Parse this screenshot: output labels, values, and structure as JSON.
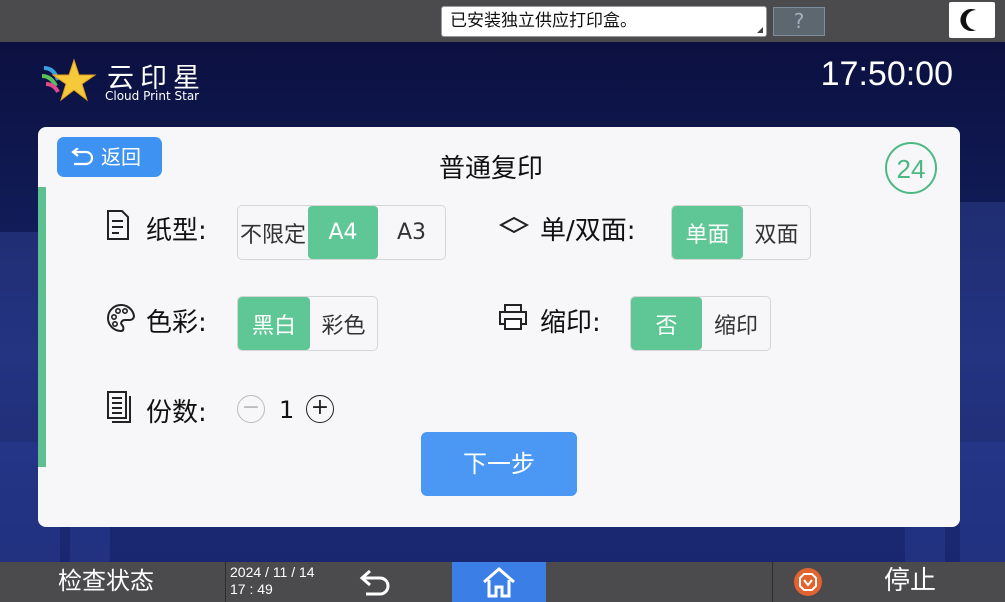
{
  "topbar": {
    "message": "已安装独立供应打印盒。",
    "help_label": "?",
    "moon_icon": "moon-icon"
  },
  "header": {
    "logo_title": "云印星",
    "logo_subtitle": "Cloud Print Star",
    "clock": "17:50:00"
  },
  "panel": {
    "back_label": "返回",
    "title": "普通复印",
    "counter": "24",
    "paper": {
      "label": "纸型:",
      "options": [
        "不限定",
        "A4",
        "A3"
      ],
      "selected": "A4"
    },
    "duplex": {
      "label": "单/双面:",
      "options": [
        "单面",
        "双面"
      ],
      "selected": "单面"
    },
    "color": {
      "label": "色彩:",
      "options": [
        "黑白",
        "彩色"
      ],
      "selected": "黑白"
    },
    "shrink": {
      "label": "缩印:",
      "options": [
        "否",
        "缩印"
      ],
      "selected": "否"
    },
    "copies": {
      "label": "份数:",
      "value": "1",
      "minus": "−",
      "plus": "+"
    },
    "next_label": "下一步"
  },
  "bottombar": {
    "check_status": "检查状态",
    "date_line1": "2024 / 11 / 14",
    "date_line2": "17 : 49",
    "stop_label": "停止"
  },
  "colors": {
    "accent_green": "#5fc795",
    "accent_blue": "#4a98f3",
    "bar_gray": "#4b4b4d",
    "stop_orange": "#e2632f"
  }
}
